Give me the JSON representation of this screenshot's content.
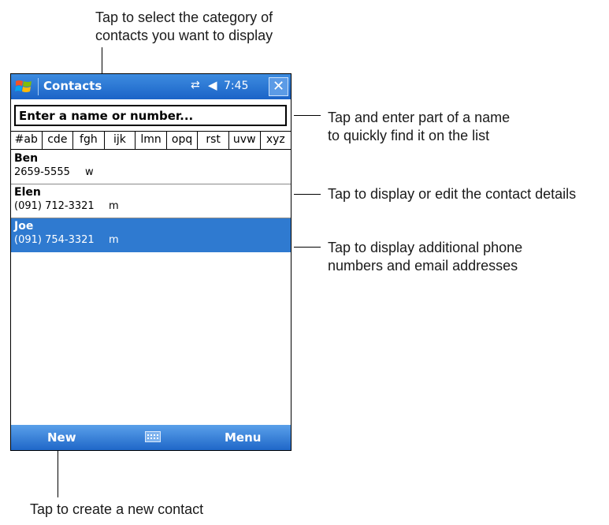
{
  "callouts": {
    "category": [
      "Tap to select the category of",
      "contacts you want to display"
    ],
    "find": [
      "Tap and enter part of a name",
      "to quickly find it on the list"
    ],
    "details": [
      "Tap to display or edit the contact details"
    ],
    "phones": [
      "Tap to display additional phone",
      "numbers and email addresses"
    ],
    "new": [
      "Tap to create a new contact"
    ]
  },
  "device": {
    "title": "Contacts",
    "time": "7:45",
    "connectivity_icon": "connectivity-icon",
    "volume_icon": "speaker-icon",
    "close_label": "✕",
    "search_text": "Enter a name or number...",
    "tabs": [
      "#ab",
      "cde",
      "fgh",
      "ijk",
      "lmn",
      "opq",
      "rst",
      "uvw",
      "xyz"
    ],
    "contacts": [
      {
        "name": "Ben",
        "phone": "2659-5555",
        "type": "w",
        "selected": false
      },
      {
        "name": "Elen",
        "phone": "(091) 712-3321",
        "type": "m",
        "selected": false
      },
      {
        "name": "Joe",
        "phone": "(091) 754-3321",
        "type": "m",
        "selected": true
      }
    ],
    "menubar": {
      "new_label": "New",
      "menu_label": "Menu",
      "keyboard_icon": "keyboard-icon"
    }
  },
  "colors": {
    "titlebar": "#1b63c7",
    "selection": "#2f7ad0",
    "menubar": "#1f67c8"
  }
}
